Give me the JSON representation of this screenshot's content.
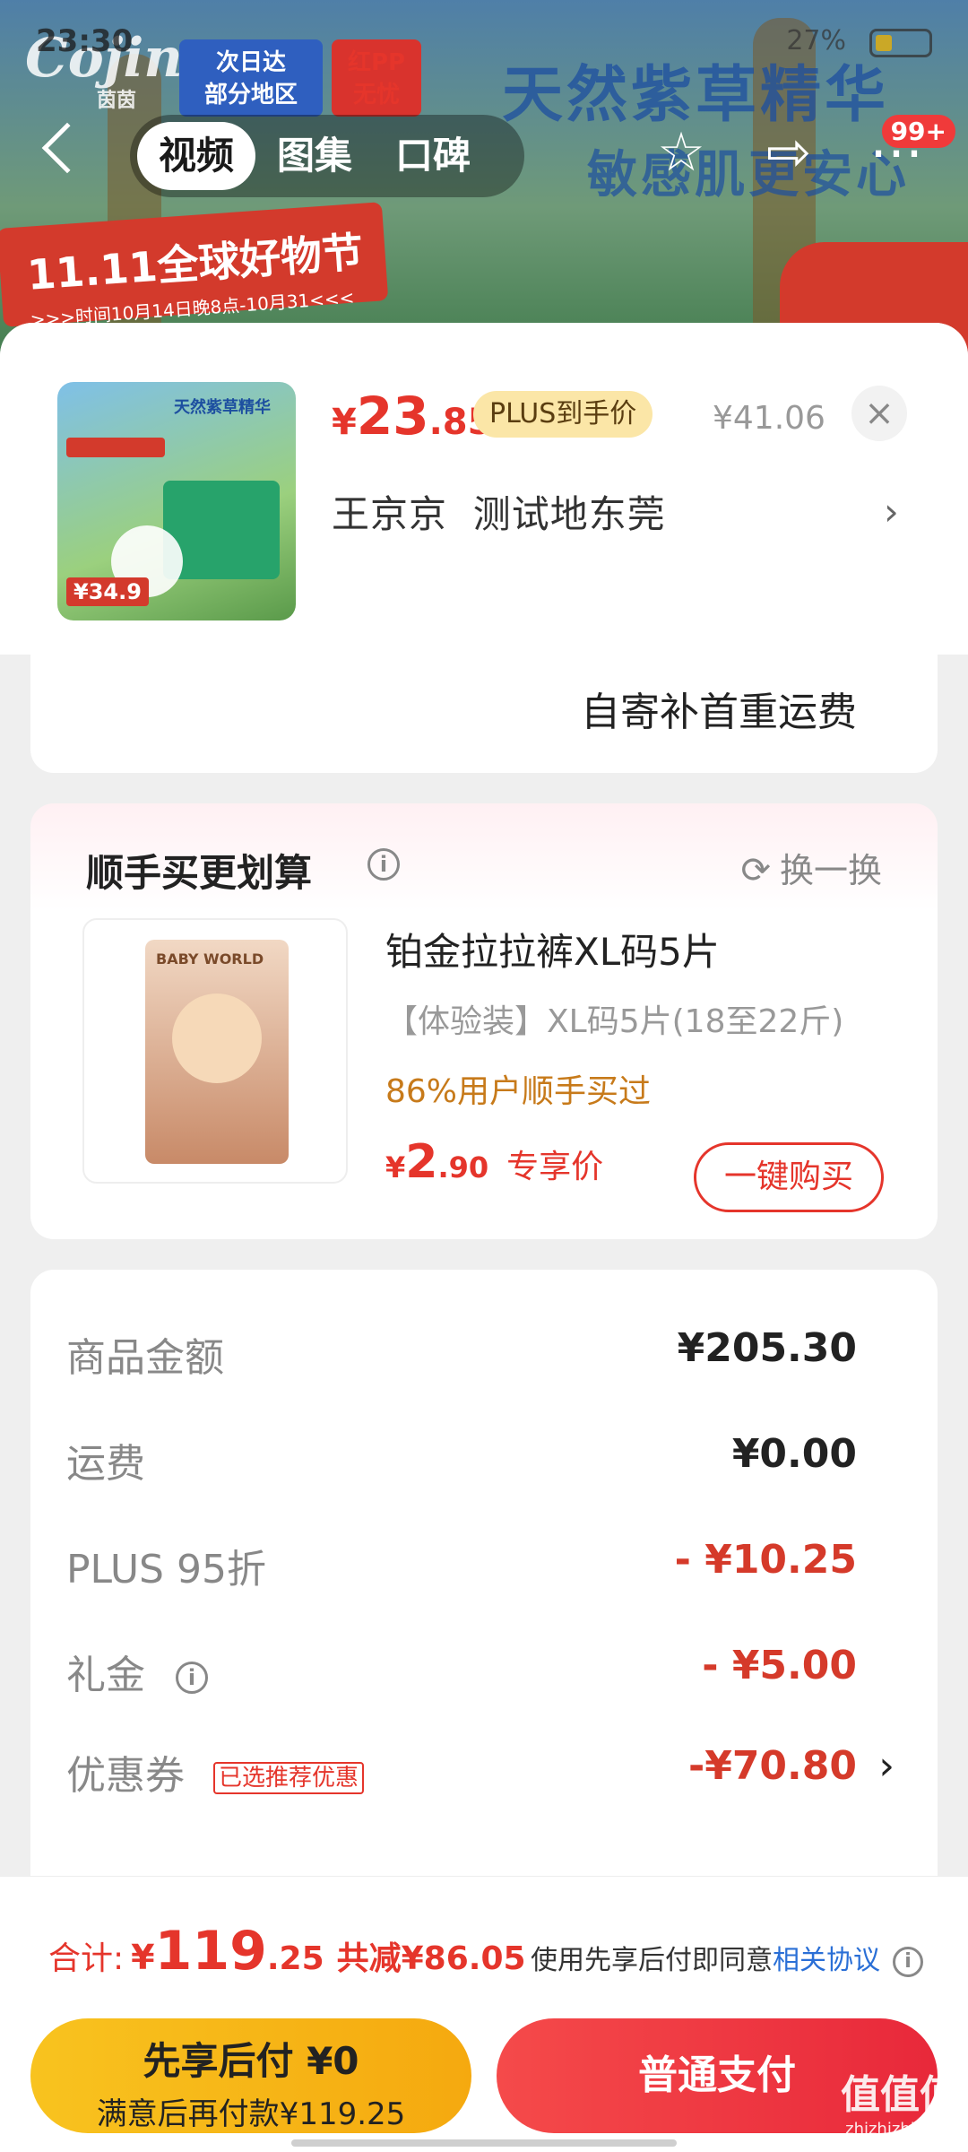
{
  "status_bar": {
    "time": "23:30",
    "battery": "27%"
  },
  "bg": {
    "logo": "Cojin",
    "logo_sub": "茵茵",
    "chip_express": "次日达\n部分地区",
    "chip_pp": "红PP\n无忧",
    "slogan_1": "天然紫草精华",
    "slogan_2": "敏感肌更安心",
    "festival": "11.11全球好物节",
    "festival_sub": ">>>时间10月14日晚8点-10月31<<<"
  },
  "nav": {
    "tabs": [
      "视频",
      "图集",
      "口碑"
    ],
    "cart_badge": "99+"
  },
  "product": {
    "thumb_title": "天然紫草精华",
    "thumb_price": "¥34.9",
    "price_yen": "¥",
    "price_int": "23",
    "price_dec": ".85",
    "plus_tag": "PLUS到手价",
    "original_price": "¥41.06",
    "address": "王京京  测试地东莞"
  },
  "shipping": {
    "text": "自寄补首重运费"
  },
  "upsell": {
    "title": "顺手买更划算",
    "refresh": "换一换",
    "img_brand": "BABY WORLD",
    "name": "铂金拉拉裤XL码5片",
    "spec": "【体验装】XL码5片(18至22斤)",
    "bought": "86%用户顺手买过",
    "price_yen": "¥",
    "price_int": "2",
    "price_dec": ".90",
    "price_label": "专享价",
    "buy_label": "一键购买"
  },
  "summary": {
    "goods_label": "商品金额",
    "goods_value": "¥205.30",
    "freight_label": "运费",
    "freight_value": "¥0.00",
    "plus_label": "PLUS 95折",
    "plus_value": "- ¥10.25",
    "gift_label": "礼金",
    "gift_value": "- ¥5.00",
    "coupon_label": "优惠券",
    "coupon_tag": "已选推荐优惠",
    "coupon_value": "-¥70.80"
  },
  "footer": {
    "total_label": "合计:",
    "total_yen": "¥",
    "total_int": "119",
    "total_dec": ".25",
    "total_saved": "共减¥86.05",
    "agree_text": "使用先享后付即同意",
    "agree_link": "相关协议",
    "later_line1": "先享后付 ¥0",
    "later_line2": "满意后再付款¥119.25",
    "pay_label": "普通支付"
  },
  "watermark": {
    "main": "值值值",
    "sub": "zhizhizhi.com"
  },
  "colors": {
    "accent_red": "#e5352b",
    "plus_gold": "#fbe6a7",
    "pay_yellow": "#f8c31f",
    "link_blue": "#2a6fd6"
  },
  "icons": {
    "back": "chevron-left-icon",
    "star": "star-icon",
    "share": "share-icon",
    "close": "close-icon",
    "info": "info-icon",
    "refresh": "refresh-icon",
    "chevron": "chevron-right-icon"
  }
}
